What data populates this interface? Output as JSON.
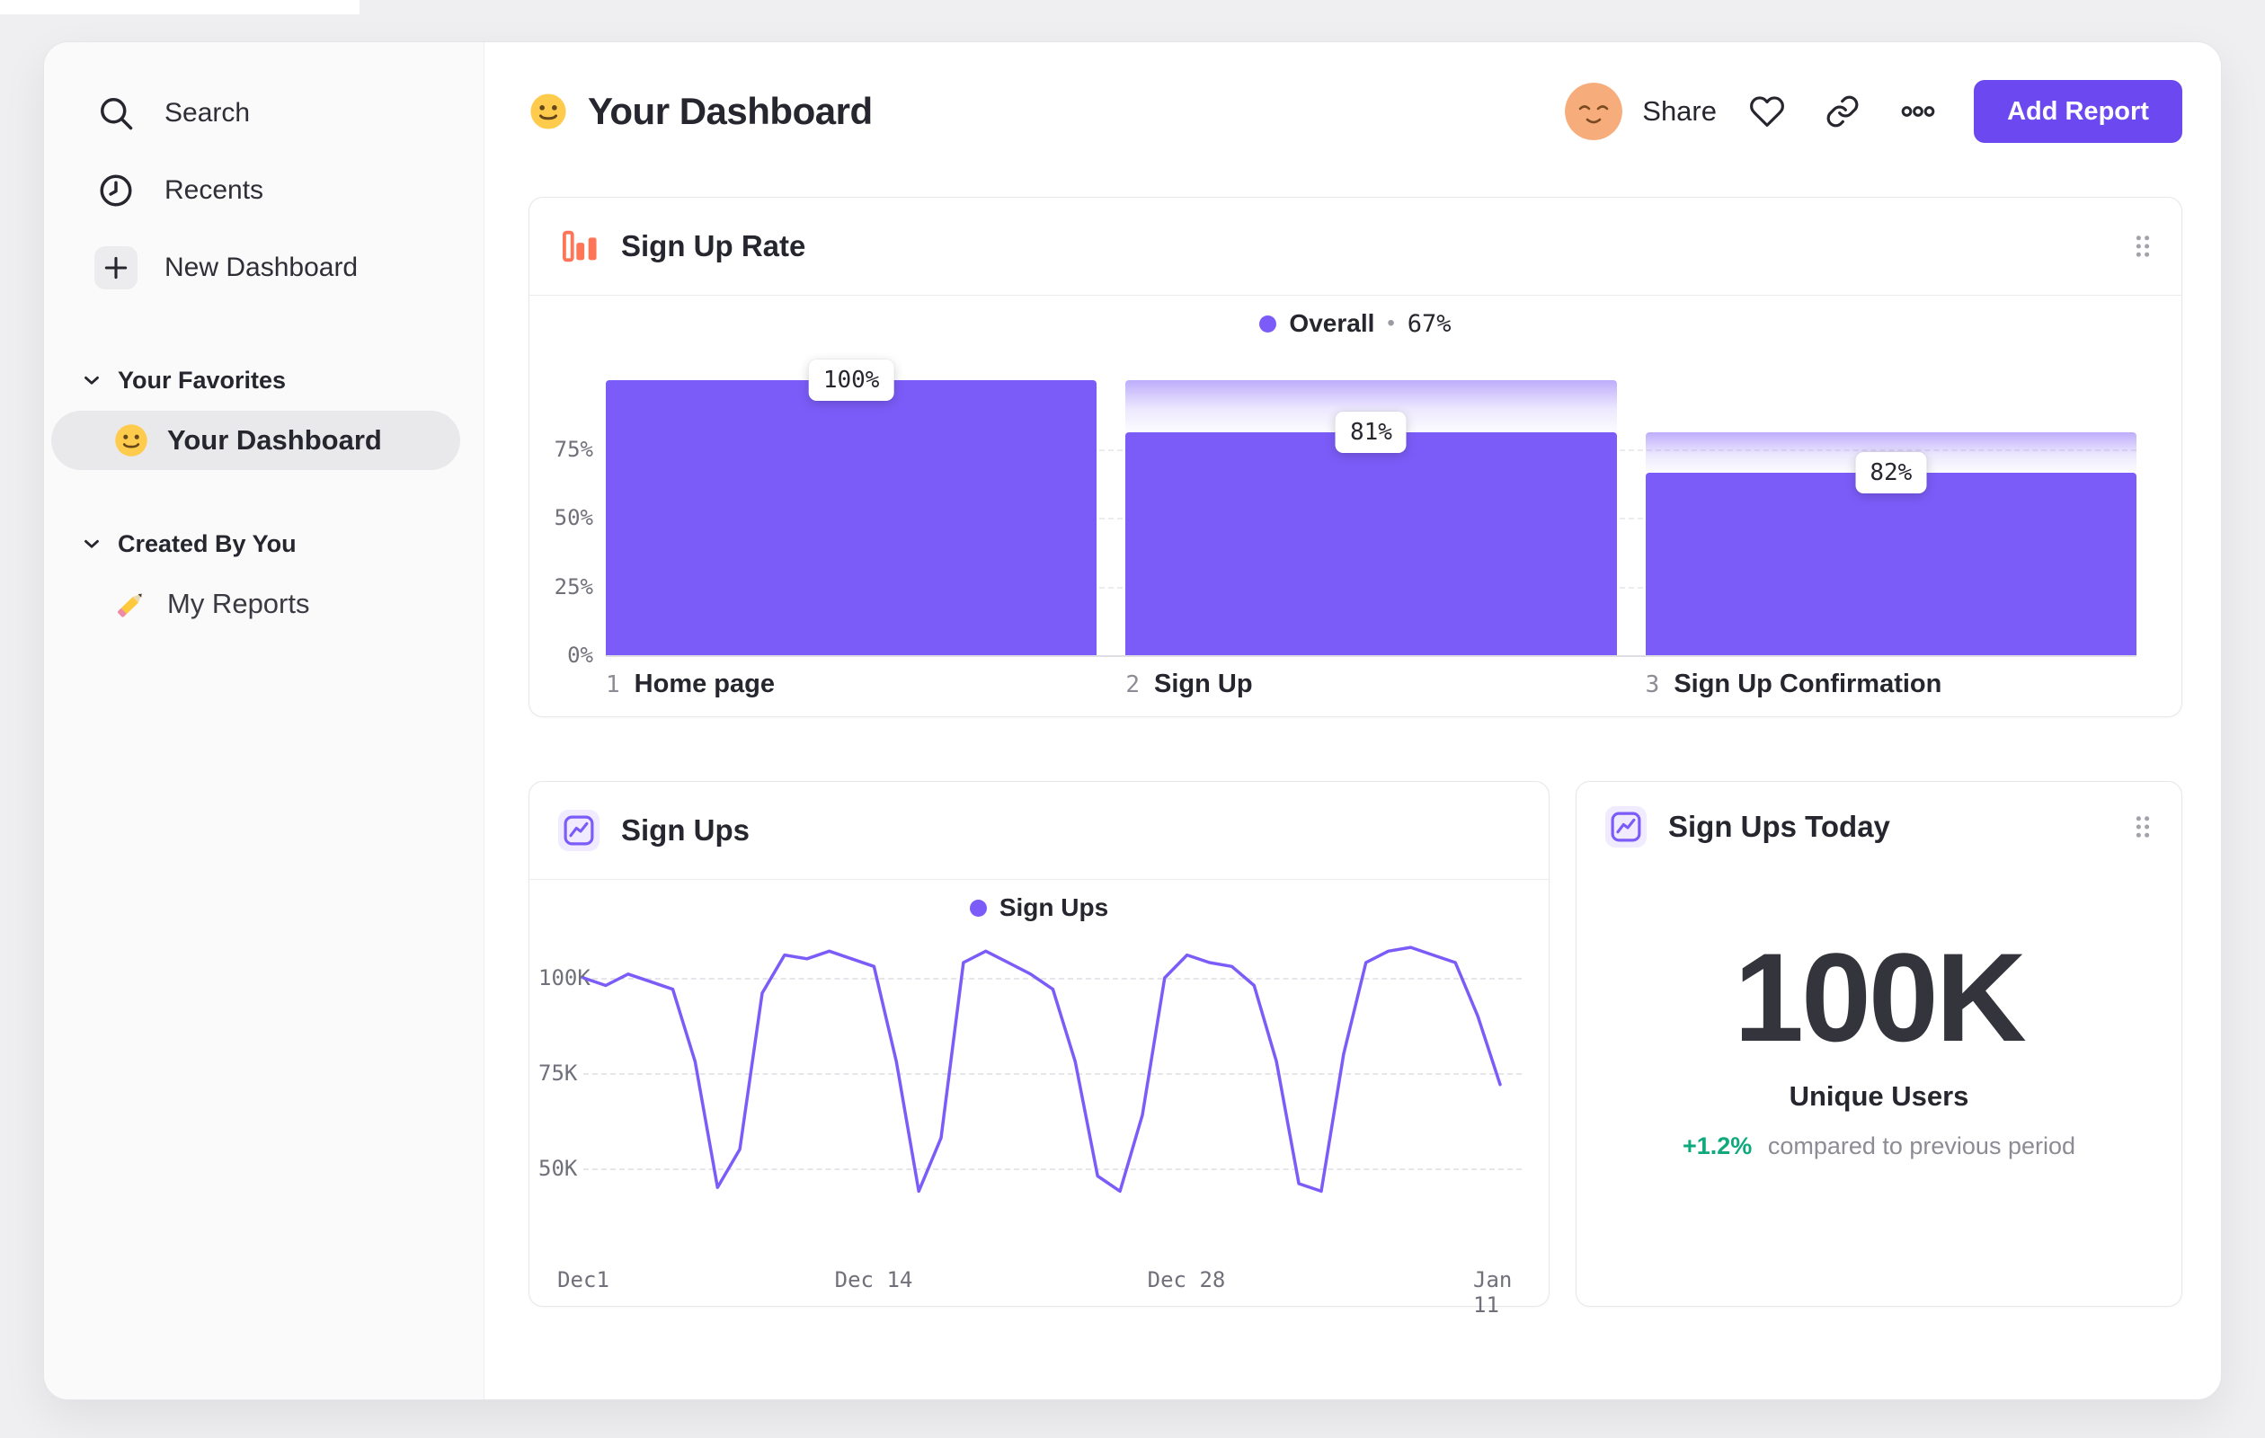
{
  "sidebar": {
    "nav": [
      {
        "label": "Search",
        "icon": "search-icon"
      },
      {
        "label": "Recents",
        "icon": "clock-icon"
      },
      {
        "label": "New Dashboard",
        "icon": "plus-icon"
      }
    ],
    "favorites_header": "Your Favorites",
    "favorite_item": "Your Dashboard",
    "created_header": "Created By You",
    "reports_item": "My Reports"
  },
  "header": {
    "title": "Your Dashboard",
    "share": "Share",
    "add_report": "Add Report"
  },
  "funnel": {
    "title": "Sign Up Rate",
    "legend": {
      "label": "Overall",
      "sep": "•",
      "value": "67%"
    },
    "y_ticks": [
      "75%",
      "50%",
      "25%",
      "0%"
    ],
    "steps": [
      {
        "num": "1",
        "name": "Home page",
        "value_label": "100%"
      },
      {
        "num": "2",
        "name": "Sign Up",
        "value_label": "81%"
      },
      {
        "num": "3",
        "name": "Sign Up Confirmation",
        "value_label": "82%"
      }
    ]
  },
  "signups": {
    "title": "Sign Ups",
    "legend": "Sign Ups",
    "y_ticks": [
      "100K",
      "75K",
      "50K"
    ],
    "x_ticks": [
      "Dec1",
      "Dec 14",
      "Dec 28",
      "Jan 11"
    ]
  },
  "today": {
    "title": "Sign Ups Today",
    "value": "100K",
    "label": "Unique Users",
    "delta": "+1.2%",
    "delta_caption": "compared to previous period"
  },
  "colors": {
    "accent_purple": "#7c5cf8",
    "button_purple": "#6b48ef",
    "funnel_icon_orange": "#ff7557",
    "delta_green": "#0fa97d"
  },
  "chart_data": [
    {
      "type": "bar",
      "subtype": "funnel",
      "title": "Sign Up Rate",
      "categories": [
        "Home page",
        "Sign Up",
        "Sign Up Confirmation"
      ],
      "values": [
        100,
        81,
        82
      ],
      "value_unit": "percent step conversion",
      "overall_conversion_pct": 67,
      "ylabel": "",
      "xlabel": "",
      "y_tick_labels": [
        "75%",
        "50%",
        "25%",
        "0%"
      ],
      "ylim": [
        0,
        100
      ],
      "legend": [
        "Overall"
      ]
    },
    {
      "type": "line",
      "title": "Sign Ups",
      "legend": [
        "Sign Ups"
      ],
      "x_unit": "day",
      "x_tick_labels": [
        "Dec1",
        "Dec 14",
        "Dec 28",
        "Jan 11"
      ],
      "x_tick_days": [
        0,
        13,
        27,
        41
      ],
      "y_tick_labels": [
        "100K",
        "75K",
        "50K"
      ],
      "ylim_thousands": [
        40,
        112
      ],
      "values_thousands": [
        100,
        98,
        101,
        99,
        97,
        78,
        45,
        55,
        96,
        106,
        105,
        107,
        105,
        103,
        78,
        44,
        58,
        104,
        107,
        104,
        101,
        97,
        78,
        48,
        44,
        64,
        100,
        106,
        104,
        103,
        98,
        78,
        46,
        44,
        80,
        104,
        107,
        108,
        106,
        104,
        90,
        72
      ]
    },
    {
      "type": "stat",
      "title": "Sign Ups Today",
      "value": "100K",
      "label": "Unique Users",
      "change": "+1.2%",
      "change_caption": "compared to previous period"
    }
  ]
}
